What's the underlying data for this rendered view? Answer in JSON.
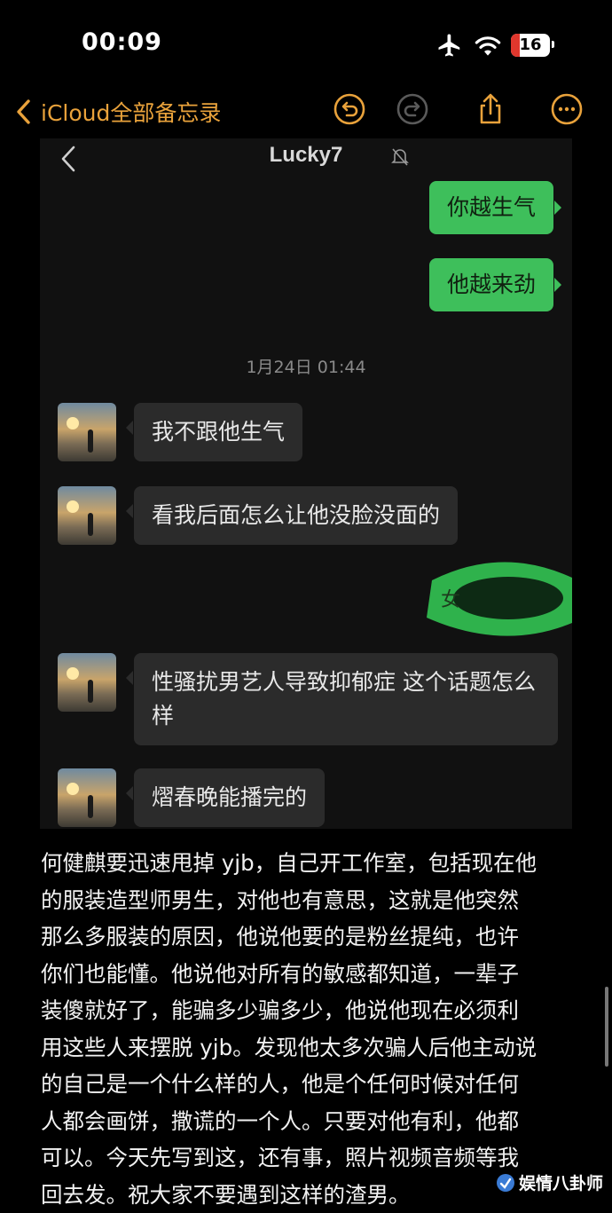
{
  "status_bar": {
    "time": "00:09",
    "battery": "16"
  },
  "nav": {
    "back_label": "iCloud全部备忘录"
  },
  "chat": {
    "title": "Lucky7",
    "timestamp": "1月24日 01:44",
    "messages": [
      {
        "side": "out",
        "text": "你越生气"
      },
      {
        "side": "out",
        "text": "他越来劲"
      },
      {
        "side": "in",
        "text": "我不跟他生气"
      },
      {
        "side": "in",
        "text": "看我后面怎么让他没脸没面的"
      },
      {
        "side": "out",
        "text": "女"
      },
      {
        "side": "in",
        "text": "性骚扰男艺人导致抑郁症 这个话题怎么样"
      },
      {
        "side": "in",
        "text": "熠春晚能播完的"
      }
    ]
  },
  "note": {
    "lines": [
      "何健麒要迅速甩掉 yjb，自己开工作室，包括现在他",
      "的服装造型师男生，对他也有意思，这就是他突然",
      "那么多服装的原因，他说他要的是粉丝提纯，也许",
      "你们也能懂。他说他对所有的敏感都知道，一辈子",
      "装傻就好了，能骗多少骗多少，他说他现在必须利",
      "用这些人来摆脱 yjb。发现他太多次骗人后他主动说",
      "的自己是一个什么样的人，他是个任何时候对任何",
      "人都会画饼，撒谎的一个人。只要对他有利，他都",
      "可以。今天先写到这，还有事，照片视频音频等我",
      "回去发。祝大家不要遇到这样的渣男。"
    ]
  },
  "watermark": "娱情八卦师",
  "colors": {
    "accent": "#e9a23b",
    "bubble_out": "#3ebf5b",
    "bubble_in": "#2b2b2b"
  },
  "icons": [
    "airplane-icon",
    "wifi-icon",
    "battery-icon",
    "chevron-left-icon",
    "undo-icon",
    "redo-icon",
    "share-icon",
    "more-icon",
    "mute-icon"
  ]
}
